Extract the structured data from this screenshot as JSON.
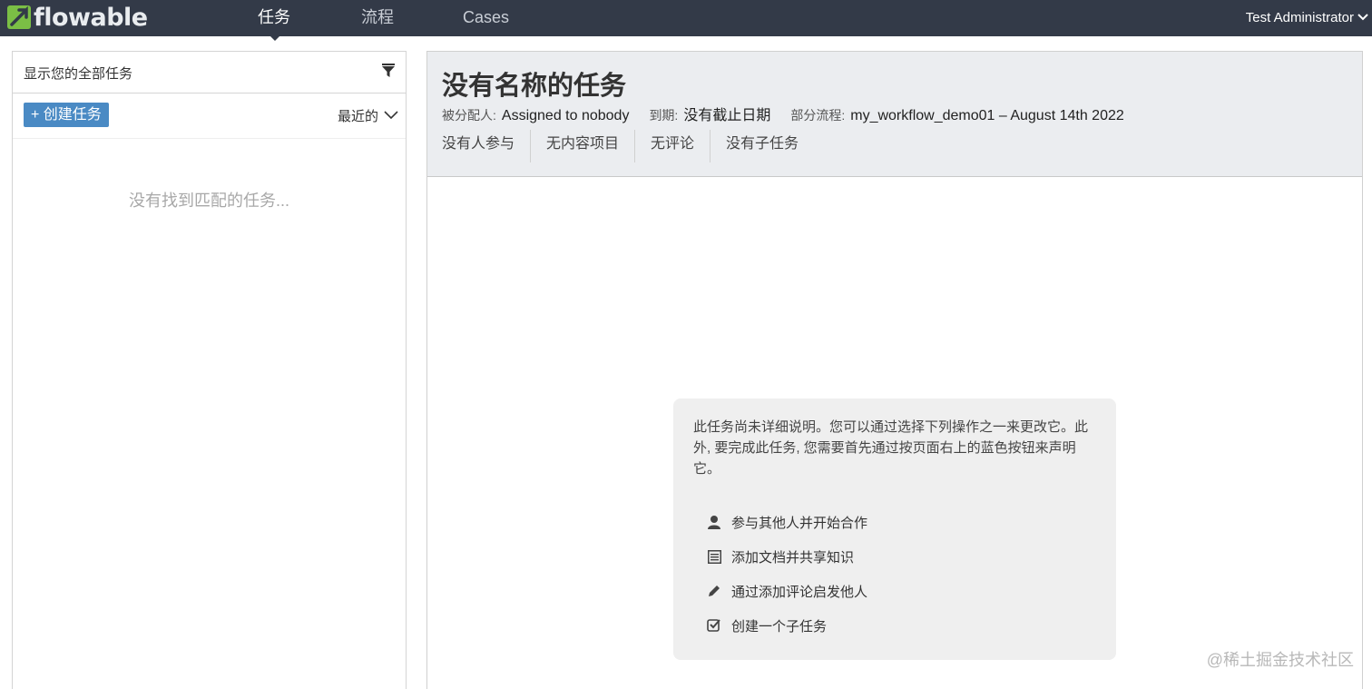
{
  "navbar": {
    "logo_text": "flowable",
    "nav_items": [
      "任务",
      "流程",
      "Cases"
    ],
    "active_index": 0,
    "user_label": "Test Administrator"
  },
  "left_panel": {
    "filter_label": "显示您的全部任务",
    "create_button": "+ 创建任务",
    "sort_label": "最近的",
    "empty_message": "没有找到匹配的任务..."
  },
  "task": {
    "title": "没有名称的任务",
    "assignee_label": "被分配人:",
    "assignee_value": "Assigned to nobody",
    "due_label": "到期:",
    "due_value": "没有截止日期",
    "process_label": "部分流程:",
    "process_value": "my_workflow_demo01 – August 14th 2022",
    "tabs": [
      "没有人参与",
      "无内容项目",
      "无评论",
      "没有子任务"
    ]
  },
  "help": {
    "text": "此任务尚未详细说明。您可以通过选择下列操作之一来更改它。此外, 要完成此任务, 您需要首先通过按页面右上的蓝色按钮来声明它。",
    "actions": [
      {
        "icon": "user-icon",
        "label": "参与其他人并开始合作"
      },
      {
        "icon": "document-icon",
        "label": "添加文档并共享知识"
      },
      {
        "icon": "pencil-icon",
        "label": "通过添加评论启发他人"
      },
      {
        "icon": "checkbox-icon",
        "label": "创建一个子任务"
      }
    ]
  },
  "watermark": "@稀土掘金技术社区",
  "colors": {
    "navbar": "#333a48",
    "logo_green": "#7bbf45",
    "primary_button": "#4a8ac4",
    "header_bg": "#ebedf0",
    "help_bg": "#efefef"
  }
}
